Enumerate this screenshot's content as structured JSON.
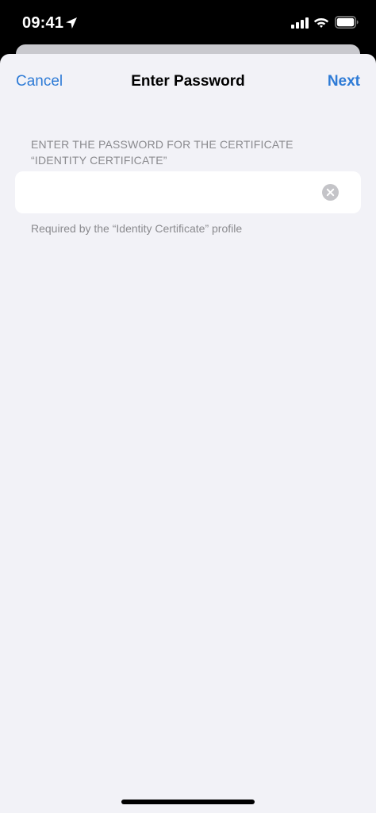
{
  "status_bar": {
    "time": "09:41",
    "icons": [
      "location-arrow-icon",
      "cellular-signal-icon",
      "wifi-icon",
      "battery-icon"
    ]
  },
  "nav": {
    "cancel_label": "Cancel",
    "title": "Enter Password",
    "next_label": "Next"
  },
  "form": {
    "section_header": "ENTER THE PASSWORD FOR THE CERTIFICATE “IDENTITY CERTIFICATE”",
    "password_value": "",
    "password_placeholder": "",
    "clear_icon": "clear-circle-icon",
    "footer": "Required by the “Identity Certificate” profile"
  },
  "colors": {
    "accent": "#2e7bd6",
    "sheet_background": "#f2f2f7",
    "secondary_text": "#8a8a8e",
    "clear_icon": "#c4c4c8"
  }
}
